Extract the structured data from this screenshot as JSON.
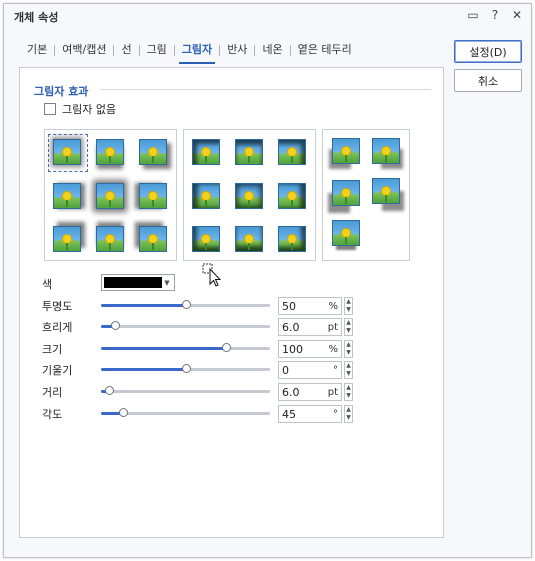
{
  "window": {
    "title": "개체 속성",
    "icons": [
      "comment-icon",
      "help-icon",
      "close-icon"
    ],
    "icon_glyphs": [
      "▭",
      "?",
      "✕"
    ]
  },
  "tabs": [
    {
      "label": "기본",
      "active": false
    },
    {
      "label": "여백/캡션",
      "active": false
    },
    {
      "label": "선",
      "active": false
    },
    {
      "label": "그림",
      "active": false
    },
    {
      "label": "그림자",
      "active": true
    },
    {
      "label": "반사",
      "active": false
    },
    {
      "label": "네온",
      "active": false
    },
    {
      "label": "옅은 테두리",
      "active": false
    }
  ],
  "section": {
    "title": "그림자 효과",
    "no_shadow_label": "그림자 없음",
    "no_shadow_checked": false
  },
  "properties": {
    "color_label": "색",
    "color_value": "#000000",
    "rows": [
      {
        "label": "투명도",
        "value": "50",
        "unit": "%",
        "fraction": 0.5
      },
      {
        "label": "흐리게",
        "value": "6.0",
        "unit": "pt",
        "fraction": 0.08
      },
      {
        "label": "크기",
        "value": "100",
        "unit": "%",
        "fraction": 0.74
      },
      {
        "label": "기울기",
        "value": "0",
        "unit": "°",
        "fraction": 0.5
      },
      {
        "label": "거리",
        "value": "6.0",
        "unit": "pt",
        "fraction": 0.05
      },
      {
        "label": "각도",
        "value": "45",
        "unit": "°",
        "fraction": 0.13
      }
    ]
  },
  "buttons": {
    "ok": "설정(D)",
    "cancel": "취소"
  },
  "colors": {
    "accent": "#2b5fb4",
    "slider_fill": "#3b68c9"
  }
}
